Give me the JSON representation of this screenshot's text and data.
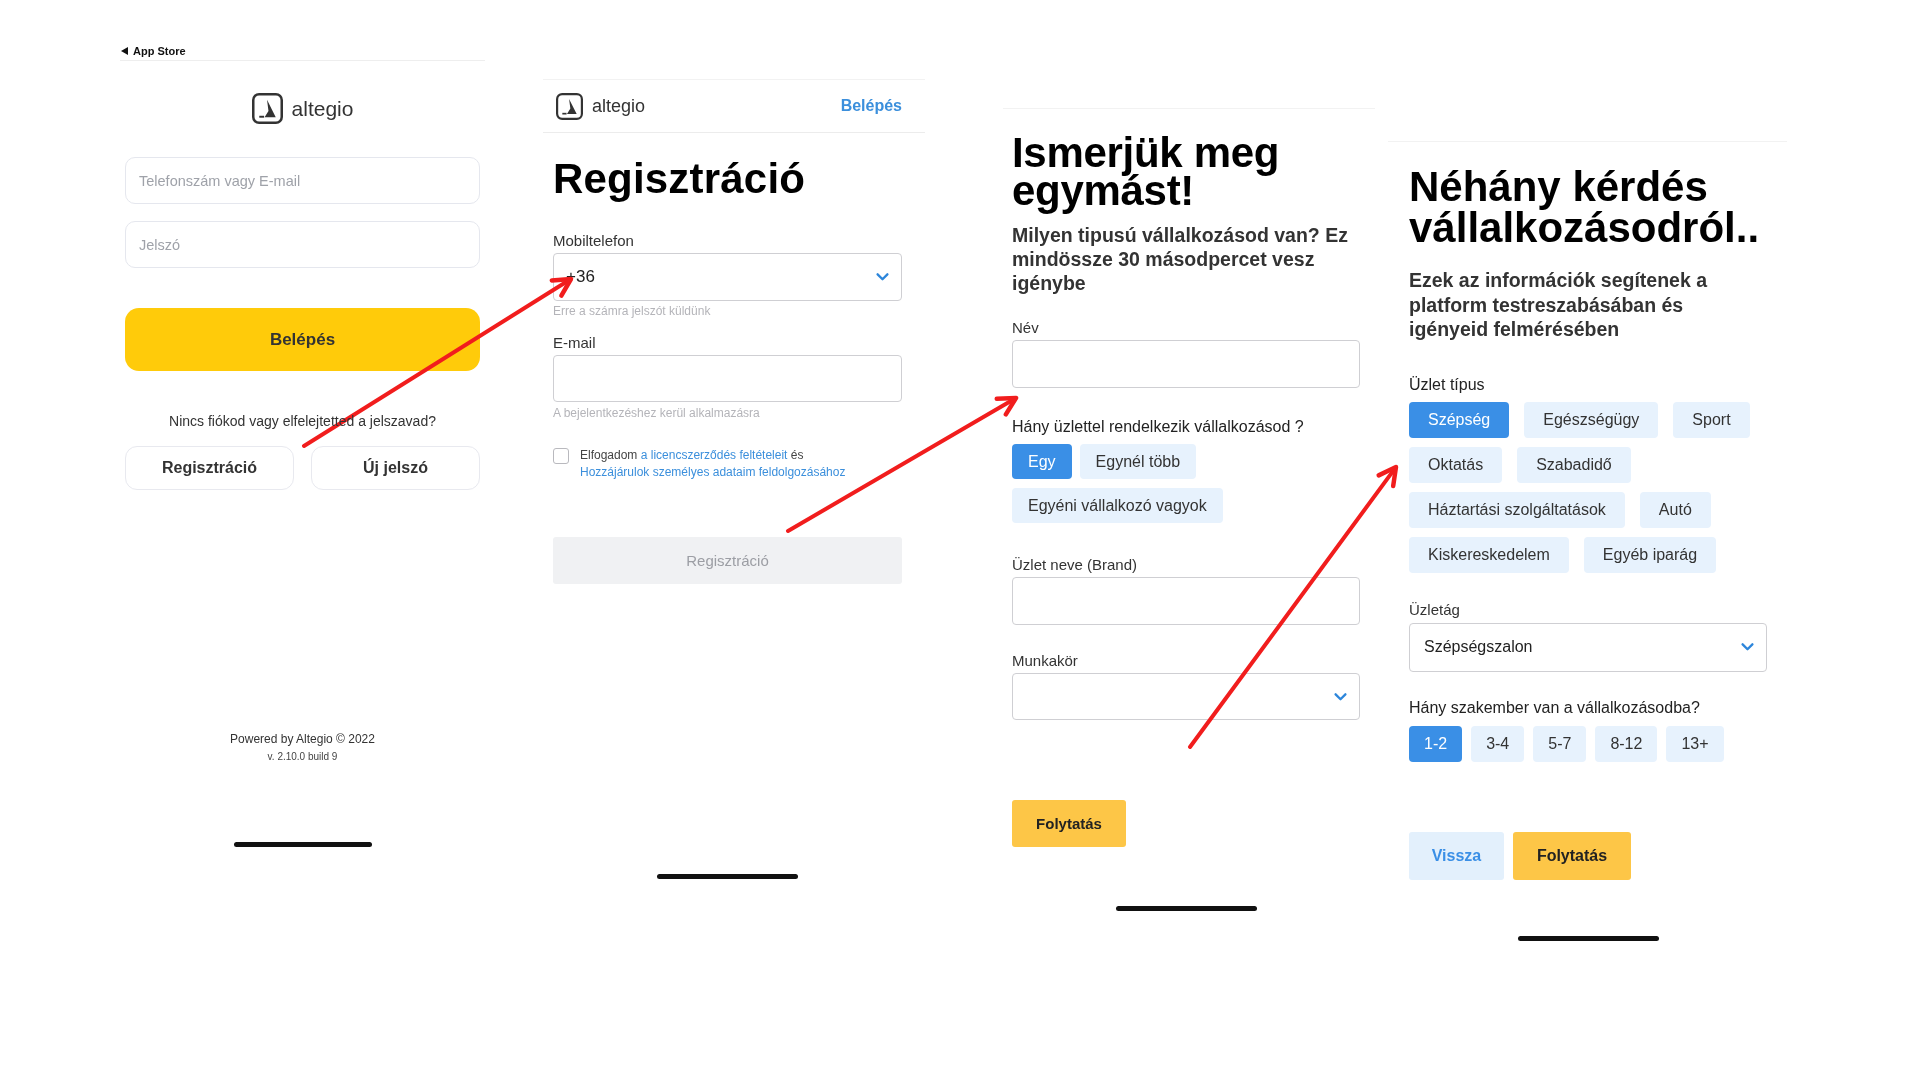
{
  "login_screen": {
    "status_bar": {
      "back_label": "App Store"
    },
    "logo_text": "altegio",
    "fields": [
      {
        "placeholder": "Telefonszám vagy E-mail"
      },
      {
        "placeholder": "Jelszó"
      }
    ],
    "login_button": "Belépés",
    "help_text": "Nincs fiókod vagy elfelejtetted a jelszavad?",
    "secondary_buttons": [
      "Regisztráció",
      "Új jelszó"
    ],
    "footer": {
      "powered_by": "Powered by Altegio © 2022",
      "version": "v. 2.10.0 build 9"
    }
  },
  "registration_screen": {
    "header": {
      "logo_text": "altegio",
      "login_link": "Belépés"
    },
    "title": "Regisztráció",
    "phone": {
      "label": "Mobiltelefon",
      "value": "+36",
      "hint": "Erre a számra jelszót küldünk"
    },
    "email": {
      "label": "E-mail",
      "hint": "A bejelentkezéshez kerül alkalmazásra"
    },
    "consent": {
      "checked": false,
      "text_before": "Elfogadom",
      "link_1": "a licencszerződés feltételeit",
      "text_middle": "és",
      "link_2": "Hozzájárulok személyes adataim feldolgozásához"
    },
    "submit_button": {
      "label": "Regisztráció",
      "disabled": true
    }
  },
  "intro_screen": {
    "title": "Ismerjük meg egymást!",
    "subtitle": "Milyen tipusú vállalkozásod van? Ez mindössze 30 másodpercet vesz igénybe",
    "name_field": {
      "label": "Név"
    },
    "location_question": "Hány üzlettel rendelkezik vállalkozásod ?",
    "location_options": [
      {
        "label": "Egy",
        "selected": true
      },
      {
        "label": "Egynél több",
        "selected": false
      },
      {
        "label": "Egyéni vállalkozó vagyok",
        "selected": false
      }
    ],
    "brand_field": {
      "label": "Üzlet neve (Brand)"
    },
    "role_field": {
      "label": "Munkakör"
    },
    "continue_button": "Folytatás"
  },
  "business_screen": {
    "title": "Néhány kérdés vállalkozásodról..",
    "subtitle": "Ezek az információk segítenek a platform testreszabásában és igényeid felmérésében",
    "business_type": {
      "label": "Üzlet típus",
      "options": [
        {
          "label": "Szépség",
          "selected": true
        },
        {
          "label": "Egészségügy",
          "selected": false
        },
        {
          "label": "Sport",
          "selected": false
        },
        {
          "label": "Oktatás",
          "selected": false
        },
        {
          "label": "Szabadidő",
          "selected": false
        },
        {
          "label": "Háztartási szolgáltatások",
          "selected": false
        },
        {
          "label": "Autó",
          "selected": false
        },
        {
          "label": "Kiskereskedelem",
          "selected": false
        },
        {
          "label": "Egyéb iparág",
          "selected": false
        }
      ]
    },
    "industry": {
      "label": "Üzletág",
      "value": "Szépségszalon"
    },
    "staff_question": {
      "label": "Hány szakember van a vállalkozásodba?",
      "options": [
        {
          "label": "1-2",
          "selected": true
        },
        {
          "label": "3-4",
          "selected": false
        },
        {
          "label": "5-7",
          "selected": false
        },
        {
          "label": "8-12",
          "selected": false
        },
        {
          "label": "13+",
          "selected": false
        }
      ]
    },
    "back_button": "Vissza",
    "continue_button": "Folytatás"
  }
}
